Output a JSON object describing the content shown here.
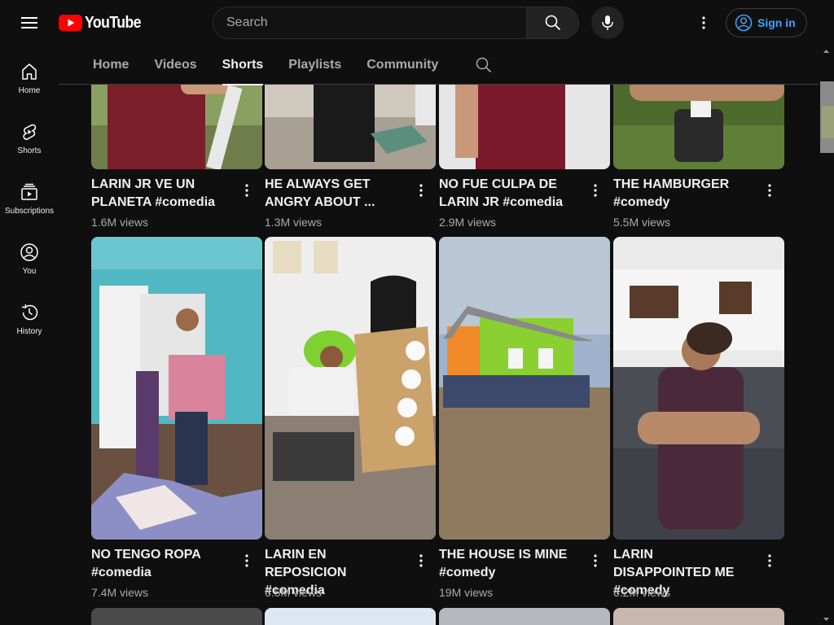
{
  "header": {
    "logo_text": "YouTube",
    "search_placeholder": "Search",
    "signin_label": "Sign in"
  },
  "sidebar": {
    "items": [
      {
        "label": "Home",
        "icon": "home-icon"
      },
      {
        "label": "Shorts",
        "icon": "shorts-icon"
      },
      {
        "label": "Subscriptions",
        "icon": "subscriptions-icon"
      },
      {
        "label": "You",
        "icon": "you-icon"
      },
      {
        "label": "History",
        "icon": "history-icon"
      }
    ]
  },
  "tabs": [
    {
      "label": "Home",
      "active": false
    },
    {
      "label": "Videos",
      "active": false
    },
    {
      "label": "Shorts",
      "active": true
    },
    {
      "label": "Playlists",
      "active": false
    },
    {
      "label": "Community",
      "active": false
    }
  ],
  "shorts": [
    {
      "title": "LARIN JR VE UN PLANETA #comedia",
      "views": "1.6M views"
    },
    {
      "title": "HE ALWAYS GET ANGRY ABOUT ...",
      "views": "1.3M views"
    },
    {
      "title": "NO FUE CULPA DE LARIN JR #comedia",
      "views": "2.9M views"
    },
    {
      "title": "THE HAMBURGER #comedy",
      "views": "5.5M views"
    },
    {
      "title": "NO TENGO ROPA #comedia",
      "views": "7.4M views"
    },
    {
      "title": "LARIN EN REPOSICION #comedia",
      "views": "6.5M views"
    },
    {
      "title": "THE HOUSE IS MINE #comedy",
      "views": "19M views"
    },
    {
      "title": "LARIN DISAPPOINTED ME #comedy",
      "views": "6.2M views"
    }
  ],
  "colors": {
    "background": "#0f0f0f",
    "brand_red": "#ff0000",
    "link_blue": "#3ea6ff",
    "secondary_text": "#aaaaaa"
  }
}
